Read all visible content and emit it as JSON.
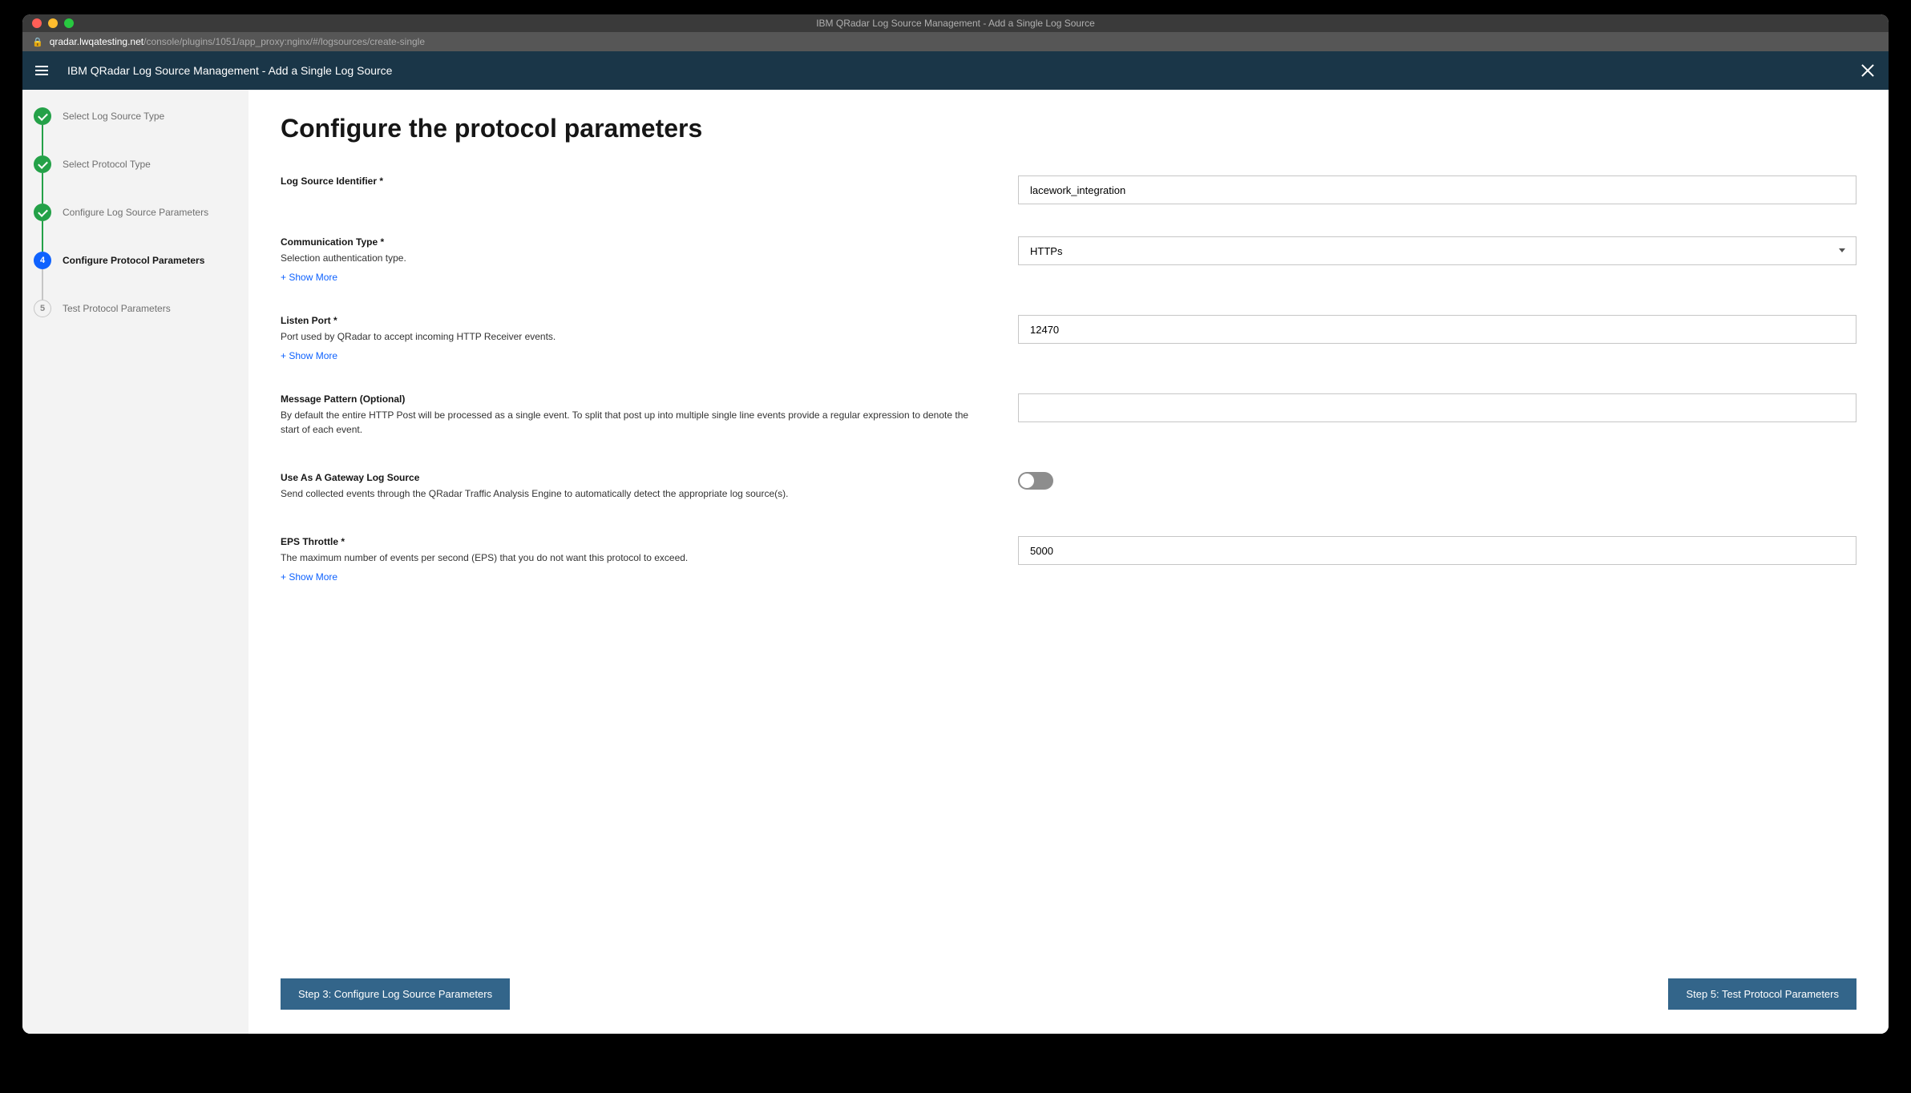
{
  "window": {
    "title": "IBM QRadar Log Source Management - Add a Single Log Source"
  },
  "url": {
    "domain": "qradar.lwqatesting.net",
    "path": "/console/plugins/1051/app_proxy:nginx/#/logsources/create-single"
  },
  "header": {
    "title": "IBM QRadar Log Source Management - Add a Single Log Source"
  },
  "steps": [
    {
      "label": "Select Log Source Type",
      "state": "complete"
    },
    {
      "label": "Select Protocol Type",
      "state": "complete"
    },
    {
      "label": "Configure Log Source Parameters",
      "state": "complete"
    },
    {
      "label": "Configure Protocol Parameters",
      "state": "current",
      "num": "4"
    },
    {
      "label": "Test Protocol Parameters",
      "state": "incomplete",
      "num": "5"
    }
  ],
  "page": {
    "title": "Configure the protocol parameters"
  },
  "form": {
    "log_source_identifier": {
      "label": "Log Source Identifier *",
      "value": "lacework_integration"
    },
    "communication_type": {
      "label": "Communication Type *",
      "desc": "Selection authentication type.",
      "show_more": "+ Show More",
      "value": "HTTPs"
    },
    "listen_port": {
      "label": "Listen Port *",
      "desc": "Port used by QRadar to accept incoming HTTP Receiver events.",
      "show_more": "+ Show More",
      "value": "12470"
    },
    "message_pattern": {
      "label": "Message Pattern (Optional)",
      "desc": "By default the entire HTTP Post will be processed as a single event. To split that post up into multiple single line events provide a regular expression to denote the start of each event.",
      "value": ""
    },
    "gateway": {
      "label": "Use As A Gateway Log Source",
      "desc": "Send collected events through the QRadar Traffic Analysis Engine to automatically detect the appropriate log source(s).",
      "toggle": false
    },
    "eps_throttle": {
      "label": "EPS Throttle *",
      "desc": "The maximum number of events per second (EPS) that you do not want this protocol to exceed.",
      "show_more": "+ Show More",
      "value": "5000"
    }
  },
  "buttons": {
    "back": "Step 3: Configure Log Source Parameters",
    "next": "Step 5: Test Protocol Parameters"
  }
}
